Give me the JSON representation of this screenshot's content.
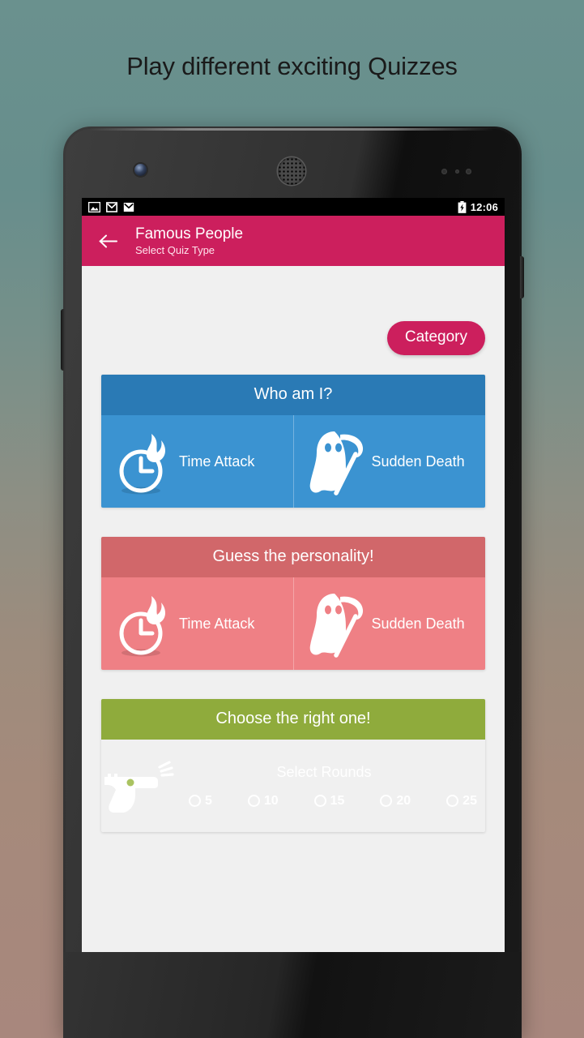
{
  "promo": {
    "headline": "Play different exciting Quizzes"
  },
  "device": {
    "status_bar": {
      "icons": [
        "image-icon",
        "gmail-icon",
        "gmail-icon"
      ],
      "battery_icon": "battery-charging-icon",
      "time": "12:06"
    },
    "nav_bar": {
      "back": "back-triangle-icon",
      "home": "home-circle-icon",
      "recents": "recents-square-icon"
    }
  },
  "app_bar": {
    "back_icon": "arrow-back-icon",
    "title": "Famous People",
    "subtitle": "Select Quiz Type",
    "color": "#cc1f5d"
  },
  "toolbar": {
    "category_label": "Category"
  },
  "cards": [
    {
      "id": "who-am-i",
      "title": "Who am I?",
      "header_color": "#2a7ab5",
      "body_color": "#3b93d1",
      "modes": [
        {
          "label": "Time Attack",
          "icon": "clock-flame-icon"
        },
        {
          "label": "Sudden Death",
          "icon": "reaper-scythe-icon"
        }
      ]
    },
    {
      "id": "guess-the-personality",
      "title": "Guess the personality!",
      "header_color": "#d1676a",
      "body_color": "#ef8085",
      "modes": [
        {
          "label": "Time Attack",
          "icon": "clock-flame-icon"
        },
        {
          "label": "Sudden Death",
          "icon": "reaper-scythe-icon"
        }
      ]
    }
  ],
  "rounds_card": {
    "id": "choose-the-right-one",
    "title": "Choose the right one!",
    "header_color": "#8fab3c",
    "body_color": "#aac361",
    "icon": "pistol-icon",
    "rounds_label": "Select Rounds",
    "options": [
      {
        "label": "5",
        "selected": false
      },
      {
        "label": "10",
        "selected": false
      },
      {
        "label": "15",
        "selected": false
      },
      {
        "label": "20",
        "selected": false
      },
      {
        "label": "25",
        "selected": false
      }
    ]
  }
}
